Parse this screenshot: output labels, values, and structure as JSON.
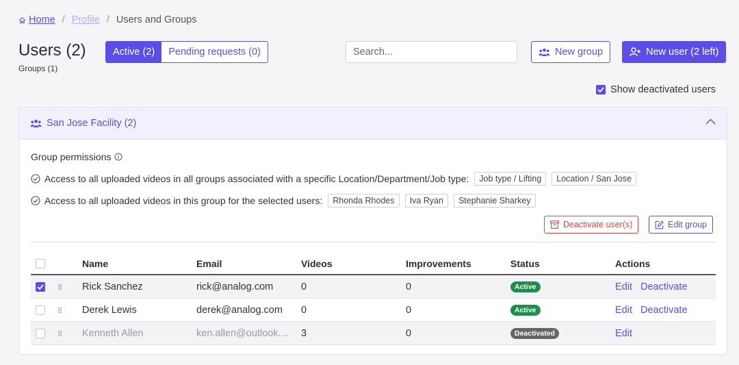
{
  "breadcrumb": {
    "home": "Home",
    "profile": "Profile",
    "current": "Users and Groups",
    "sep": "/"
  },
  "header": {
    "title": "Users (2)",
    "groups_count": "Groups (1)",
    "tabs": [
      {
        "label": "Active (2)",
        "active": true
      },
      {
        "label": "Pending requests (0)",
        "active": false
      }
    ],
    "search_placeholder": "Search...",
    "new_group_label": "New group",
    "new_user_label": "New user (2 left)"
  },
  "show_deactivated": {
    "label": "Show deactivated users",
    "checked": true
  },
  "group": {
    "name": "San Jose Facility (2)",
    "permissions_title": "Group permissions",
    "perm1_text": "Access to all uploaded videos in all groups associated with a specific Location/Department/Job type:",
    "perm1_tags": [
      "Job type / Lifting",
      "Location / San Jose"
    ],
    "perm2_text": "Access to all uploaded videos in this group for the selected users:",
    "perm2_tags": [
      "Rhonda Rhodes",
      "Iva Ryan",
      "Stephanie Sharkey"
    ],
    "deactivate_label": "Deactivate user(s)",
    "edit_group_label": "Edit group"
  },
  "table": {
    "columns": [
      "Name",
      "Email",
      "Videos",
      "Improvements",
      "Status",
      "Actions"
    ],
    "rows": [
      {
        "name": "Rick Sanchez",
        "email": "rick@analog.com",
        "videos": "0",
        "improvements": "0",
        "status": "Active",
        "edit": "Edit",
        "deactivate": "Deactivate",
        "checked": true
      },
      {
        "name": "Derek Lewis",
        "email": "derek@analog.com",
        "videos": "0",
        "improvements": "0",
        "status": "Active",
        "edit": "Edit",
        "deactivate": "Deactivate",
        "checked": false
      },
      {
        "name": "Kenneth Allen",
        "email": "ken.allen@outlook....",
        "videos": "3",
        "improvements": "0",
        "status": "Deactivated",
        "edit": "Edit",
        "checked": false
      }
    ]
  },
  "colors": {
    "accent": "#5b4ee6",
    "danger": "#d9463b",
    "active_badge": "#1e8e4e",
    "deactivated_badge": "#666666"
  }
}
